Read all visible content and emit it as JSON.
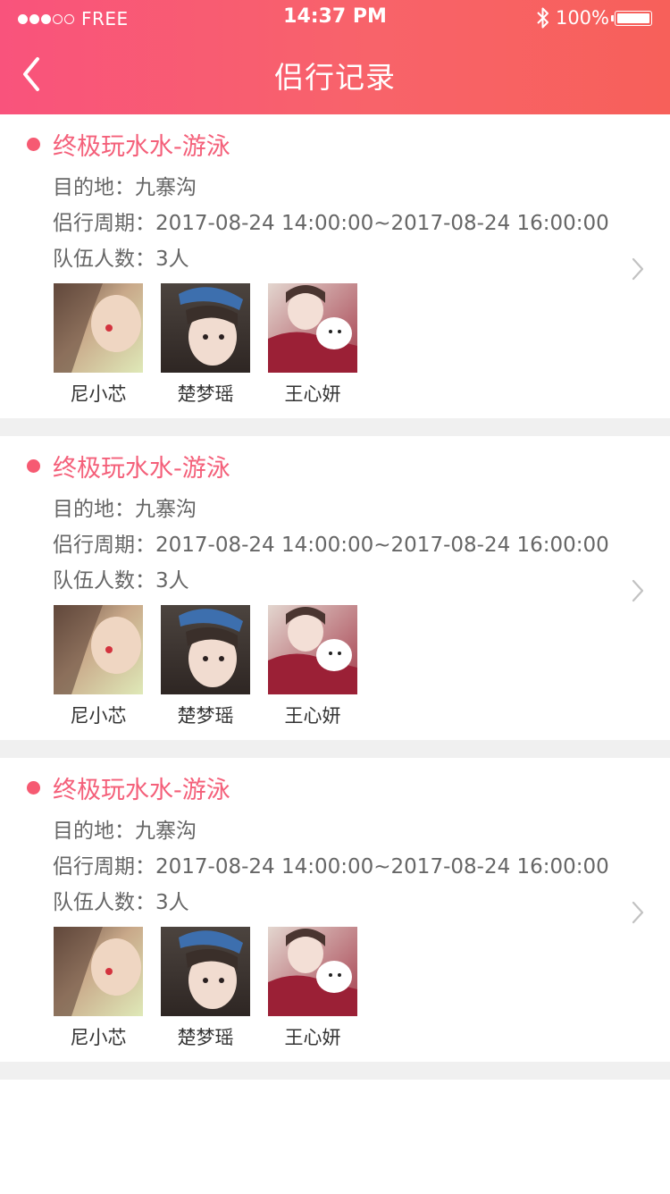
{
  "status_bar": {
    "carrier": "FREE",
    "time": "14:37 PM",
    "battery": "100%",
    "signal_full": 3,
    "signal_empty": 2
  },
  "nav": {
    "title": "侣行记录"
  },
  "colors": {
    "accent": "#f65a72",
    "header_start": "#f9537c",
    "header_end": "#f7605a",
    "separator": "#f0f0f0"
  },
  "trips": [
    {
      "title": "终极玩水水-游泳",
      "destination": "目的地：九寨沟",
      "period": "侣行周期：2017-08-24 14:00:00~2017-08-24 16:00:00",
      "team_size": "队伍人数：3人",
      "members": [
        {
          "name": "尼小芯"
        },
        {
          "name": "楚梦瑶"
        },
        {
          "name": "王心妍"
        }
      ]
    },
    {
      "title": "终极玩水水-游泳",
      "destination": "目的地：九寨沟",
      "period": "侣行周期：2017-08-24 14:00:00~2017-08-24 16:00:00",
      "team_size": "队伍人数：3人",
      "members": [
        {
          "name": "尼小芯"
        },
        {
          "name": "楚梦瑶"
        },
        {
          "name": "王心妍"
        }
      ]
    },
    {
      "title": "终极玩水水-游泳",
      "destination": "目的地：九寨沟",
      "period": "侣行周期：2017-08-24 14:00:00~2017-08-24 16:00:00",
      "team_size": "队伍人数：3人",
      "members": [
        {
          "name": "尼小芯"
        },
        {
          "name": "楚梦瑶"
        },
        {
          "name": "王心妍"
        }
      ]
    }
  ]
}
